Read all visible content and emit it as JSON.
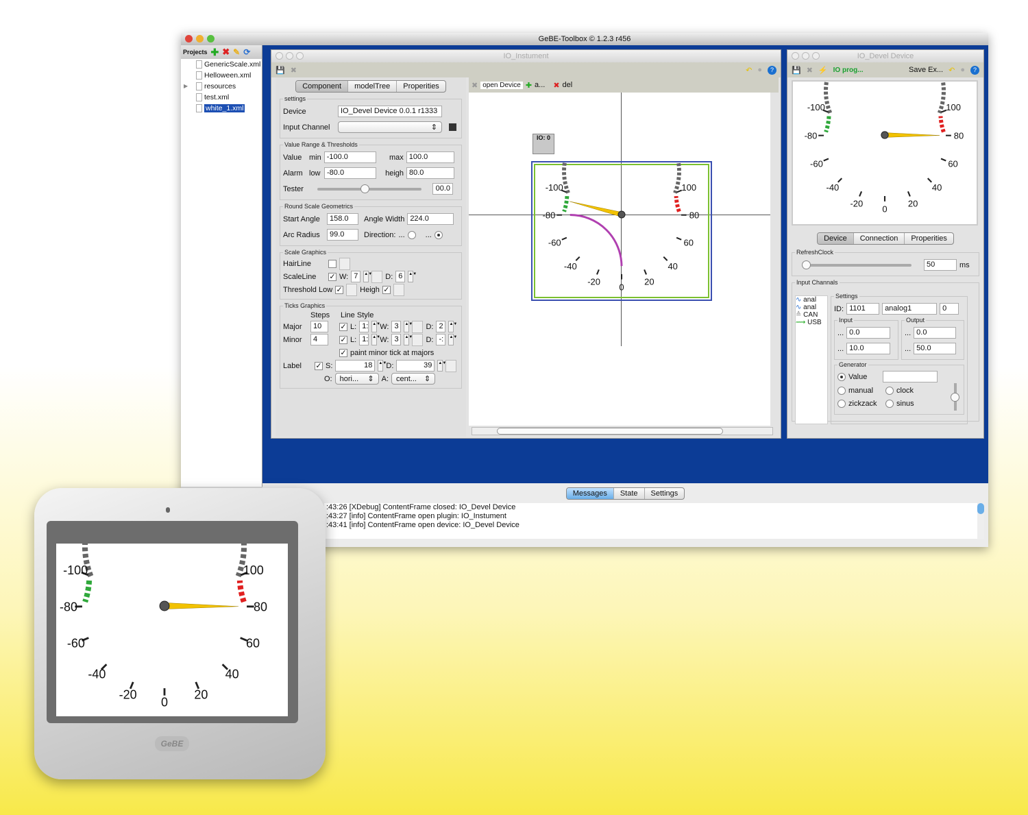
{
  "app": {
    "title": "GeBE-Toolbox © 1.2.3 r456"
  },
  "projects": {
    "header": "Projects",
    "items": [
      {
        "label": "GenericScale.xml"
      },
      {
        "label": "Helloween.xml"
      },
      {
        "label": "resources"
      },
      {
        "label": "test.xml"
      },
      {
        "label": "white_1.xml"
      }
    ]
  },
  "instrument_window": {
    "title": "IO_Instument",
    "tabs": [
      "Component",
      "modelTree",
      "Properities"
    ],
    "canvas_toolbar": {
      "open_device": "open Device",
      "add": "a...",
      "del": "del"
    },
    "io_badge": "IO: 0",
    "settings": {
      "legend": "settings",
      "device_label": "Device",
      "device_value": "IO_Devel Device 0.0.1 r1333",
      "input_channel_label": "Input Channel",
      "input_channel_value": ""
    },
    "value_range": {
      "legend": "Value Range & Thresholds",
      "value_label": "Value",
      "min_label": "min",
      "min_value": "-100.0",
      "max_label": "max",
      "max_value": "100.0",
      "alarm_label": "Alarm",
      "low_label": "low",
      "low_value": "-80.0",
      "heigh_label": "heigh",
      "heigh_value": "80.0",
      "tester_label": "Tester",
      "tester_value": "00.0",
      "tester_fraction": 0.45
    },
    "round_scale": {
      "legend": "Round Scale Geometrics",
      "start_angle_label": "Start Angle",
      "start_angle_value": "158.0",
      "angle_width_label": "Angle Width",
      "angle_width_value": "224.0",
      "arc_radius_label": "Arc Radius",
      "arc_radius_value": "99.0",
      "direction_label": "Direction:",
      "dir_opt": "..."
    },
    "scale_graphics": {
      "legend": "Scale Graphics",
      "hairline_label": "HairLine",
      "scaleline_label": "ScaleLine",
      "w_label": "W:",
      "w_value": "7",
      "d_label": "D:",
      "d_value": "6",
      "threshold_low_label": "Threshold Low",
      "heigh_label": "Heigh"
    },
    "ticks_graphics": {
      "legend": "Ticks Graphics",
      "steps_label": "Steps",
      "line_style_label": "Line Style",
      "major_label": "Major",
      "major_steps": "10",
      "major_l": "1:",
      "major_w": "3",
      "major_d": "2",
      "minor_label": "Minor",
      "minor_steps": "4",
      "minor_l": "1:",
      "minor_w": "3",
      "minor_d": "-:",
      "l_label": "L:",
      "w_label": "W:",
      "d_label": "D:",
      "paint_minor": "paint minor tick at majors",
      "label_label": "Label",
      "s_label": "S:",
      "s_value": "18",
      "ld_value": "39",
      "o_label": "O:",
      "o_value": "hori...",
      "a_label": "A:",
      "a_value": "cent..."
    }
  },
  "device_window": {
    "title": "IO_Devel Device",
    "io_prog": "IO prog...",
    "save_ex": "Save Ex...",
    "tabs": [
      "Device",
      "Connection",
      "Properities"
    ],
    "refresh": {
      "legend": "RefreshClock",
      "value": "50",
      "unit": "ms",
      "fraction": 0.0
    },
    "input_channels": {
      "legend": "Input Channals",
      "list": [
        "anal",
        "anal",
        "CAN",
        "USB"
      ],
      "settings_legend": "Settings",
      "id_label": "ID:",
      "id_value": "1101",
      "name_value": "analog1",
      "index_value": "0",
      "input_legend": "Input",
      "output_legend": "Output",
      "dots": "...",
      "input_min": "0.0",
      "input_max": "10.0",
      "output_min": "0.0",
      "output_max": "50.0",
      "generator_legend": "Generator",
      "gen_value": "Value",
      "gen_manual": "manual",
      "gen_clock": "clock",
      "gen_zickzack": "zickzack",
      "gen_sinus": "sinus"
    }
  },
  "log": {
    "tabs": [
      "Messages",
      "State",
      "Settings"
    ],
    "lines": [
      ":43:26 [XDebug] ContentFrame closed: IO_Devel Device",
      ":43:27 [info] ContentFrame open plugin: IO_Instument",
      ":43:41 [info] ContentFrame open device: IO_Devel Device"
    ]
  },
  "device_logo": "GeBE",
  "gauge": {
    "min": -100,
    "max": 100,
    "start_angle": 158,
    "angle_width": 224,
    "alarm_low": -80,
    "alarm_high": 80,
    "labels": [
      "-100",
      "-80",
      "-60",
      "-40",
      "-20",
      "0",
      "20",
      "40",
      "60",
      "80",
      "100"
    ],
    "editor_value": -93,
    "device_value": 80,
    "colors": {
      "low": "#2fa83a",
      "high": "#e02020",
      "scale": "#666666",
      "needle": "#f2c200",
      "highlight": "#b040b0"
    }
  }
}
